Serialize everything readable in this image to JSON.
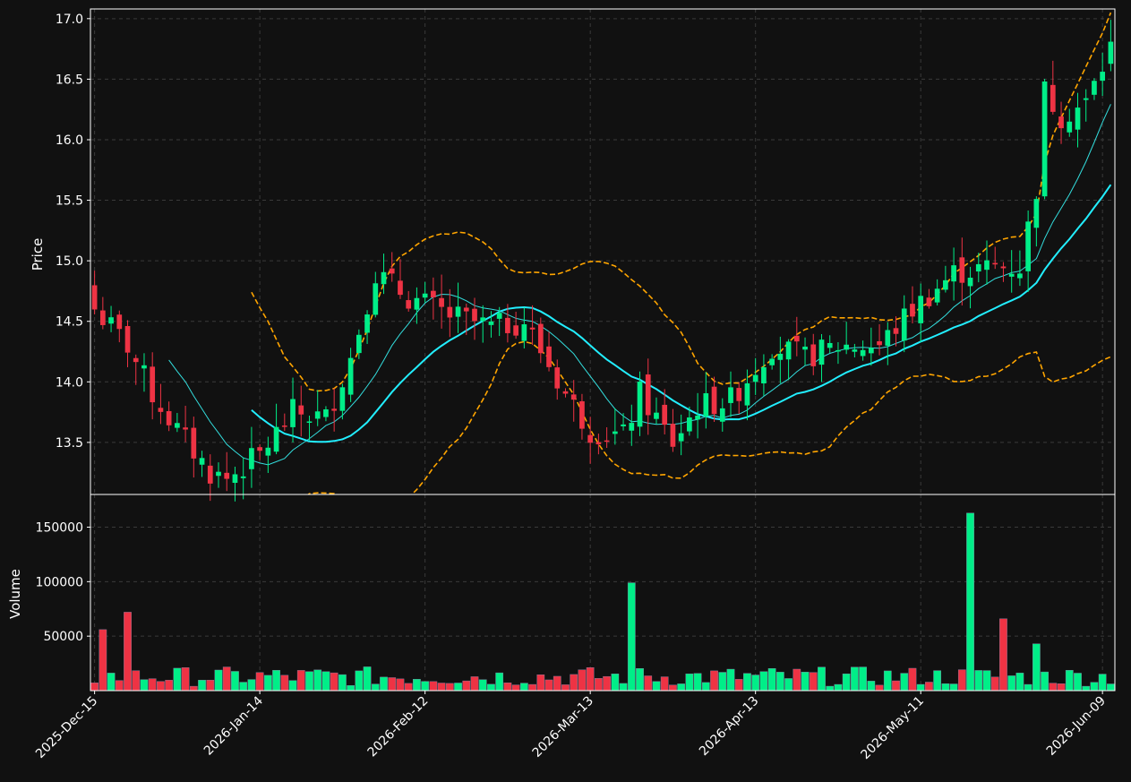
{
  "chart_data": {
    "type": "candlestick",
    "colors": {
      "background": "#111111",
      "up": "#00ee88",
      "down": "#ee3344",
      "ma_fast": "#33dddd",
      "ma_slow": "#22eeff",
      "bands": "#ffa500",
      "grid": "#3a3a3a",
      "frame": "#ffffff"
    },
    "price_panel": {
      "ylabel": "Price",
      "ylim": [
        13.07,
        17.08
      ],
      "yticks": [
        "13.5",
        "14.0",
        "14.5",
        "15.0",
        "15.5",
        "16.0",
        "16.5",
        "17.0"
      ],
      "grid": true
    },
    "volume_panel": {
      "ylabel": "Volume",
      "ylim": [
        0,
        180000
      ],
      "yticks": [
        "50000",
        "100000",
        "150000"
      ],
      "grid": true
    },
    "x_tick_labels": [
      "2025-Dec-15",
      "2026-Jan-14",
      "2026-Feb-12",
      "2026-Mar-13",
      "2026-Apr-13",
      "2026-May-11",
      "2026-Jun-09"
    ],
    "x_tick_bar_index": [
      0,
      20,
      40,
      60,
      80,
      100,
      122
    ],
    "series": [
      {
        "name": "Price",
        "type": "ohlc"
      },
      {
        "name": "MA fast",
        "type": "line",
        "start_index": 9
      },
      {
        "name": "MA slow",
        "type": "line",
        "start_index": 19
      },
      {
        "name": "Upper band",
        "type": "line",
        "start_index": 19
      },
      {
        "name": "Lower band",
        "type": "line",
        "start_index": 19
      },
      {
        "name": "Volume",
        "type": "bar"
      }
    ]
  }
}
